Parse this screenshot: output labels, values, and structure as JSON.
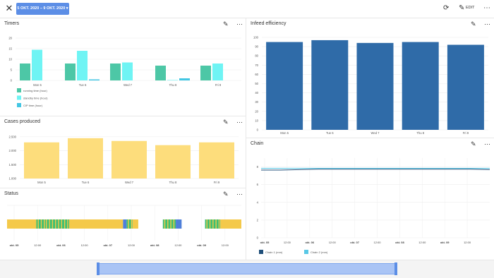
{
  "header": {
    "date_range": "5 OKT. 2020 – 9 OKT. 2020 ▾",
    "edit_label": "EDIT",
    "close_icon": "close-icon",
    "refresh_icon": "refresh-icon",
    "pencil_icon": "pencil-icon",
    "more_icon": "more-vert-icon"
  },
  "colors": {
    "running": "#4dc7a6",
    "standby": "#6ff4f4",
    "cip": "#43c6e3",
    "efficiency": "#2f6ba8",
    "cases": "#fddd7c",
    "status_yellow": "#f4c94a",
    "status_green": "#3dbf73",
    "status_blue": "#4f7fd9",
    "chain1": "#1f4e79",
    "chain2": "#59c8e6"
  },
  "panels": {
    "timers": {
      "title": "Timers"
    },
    "efficiency": {
      "title": "Infeed efficiency"
    },
    "cases": {
      "title": "Cases produced"
    },
    "chain": {
      "title": "Chain"
    },
    "status": {
      "title": "Status"
    }
  },
  "chart_data": [
    {
      "id": "timers",
      "type": "bar",
      "categories": [
        "Mon 5",
        "Tue 6",
        "Wed 7",
        "Thu 8",
        "Fri 9"
      ],
      "series": [
        {
          "name": "running time (hour)",
          "values": [
            8,
            8,
            8,
            7,
            7
          ]
        },
        {
          "name": "standby time (hour)",
          "values": [
            14.5,
            14,
            8.5,
            0.2,
            8
          ]
        },
        {
          "name": "CIP time (hour)",
          "values": [
            0,
            0.5,
            0,
            1,
            0
          ]
        }
      ],
      "yticks": [
        "20",
        "15",
        "10",
        "5",
        "0"
      ],
      "ylim": [
        0,
        20
      ]
    },
    {
      "id": "efficiency",
      "type": "bar",
      "categories": [
        "Mon 5",
        "Tue 6",
        "Wed 7",
        "Thu 8",
        "Fri 9"
      ],
      "values": [
        95,
        97,
        94,
        95,
        92
      ],
      "yticks": [
        "100",
        "90",
        "80",
        "70",
        "60",
        "50",
        "40",
        "30",
        "20",
        "10",
        "0"
      ],
      "ylim": [
        0,
        100
      ]
    },
    {
      "id": "cases",
      "type": "bar",
      "categories": [
        "Mon 5",
        "Tue 6",
        "Wed 7",
        "Thu 8",
        "Fri 9"
      ],
      "values": [
        2300,
        2450,
        2350,
        2200,
        2300
      ],
      "yticks": [
        "2.500",
        "2.000",
        "1.500",
        "1.000"
      ],
      "ylim": [
        1000,
        2700
      ]
    },
    {
      "id": "chain",
      "type": "line",
      "xticks": [
        "okt. 05",
        "12:00",
        "okt. 06",
        "12:00",
        "okt. 07",
        "12:00",
        "okt. 08",
        "12:00",
        "okt. 09",
        "12:00"
      ],
      "yticks": [
        "8",
        "6",
        "4",
        "2",
        "0"
      ],
      "ylim": [
        0,
        9
      ],
      "series": [
        {
          "name": "Chain 1 (mm)",
          "values": [
            7.65,
            7.65,
            7.7,
            7.75,
            7.75,
            7.75,
            7.75,
            7.75,
            7.75,
            7.75,
            7.75,
            7.75,
            7.7
          ]
        },
        {
          "name": "Chain 2 (mm)",
          "values": [
            7.85,
            7.85,
            7.85,
            7.85,
            7.85,
            7.85,
            7.85,
            7.85,
            7.85,
            7.85,
            7.85,
            7.85,
            7.85
          ]
        }
      ]
    },
    {
      "id": "status",
      "type": "timeline",
      "xticks": [
        "okt. 05",
        "12:00",
        "okt. 06",
        "12:00",
        "okt. 07",
        "12:00",
        "okt. 08",
        "12:00",
        "okt. 09",
        "12:00"
      ],
      "segments": [
        {
          "start": 0.0,
          "end": 0.125,
          "state": "status_yellow"
        },
        {
          "start": 0.125,
          "end": 0.16,
          "state": "status_green"
        },
        {
          "start": 0.16,
          "end": 0.265,
          "state": "status_green"
        },
        {
          "start": 0.265,
          "end": 0.495,
          "state": "status_yellow"
        },
        {
          "start": 0.495,
          "end": 0.51,
          "state": "status_blue"
        },
        {
          "start": 0.51,
          "end": 0.535,
          "state": "status_green"
        },
        {
          "start": 0.535,
          "end": 0.56,
          "state": "status_yellow"
        },
        {
          "start": 0.665,
          "end": 0.72,
          "state": "status_green"
        },
        {
          "start": 0.72,
          "end": 0.745,
          "state": "status_blue"
        },
        {
          "start": 0.845,
          "end": 0.91,
          "state": "status_green"
        },
        {
          "start": 0.91,
          "end": 1.0,
          "state": "status_yellow"
        }
      ]
    }
  ]
}
